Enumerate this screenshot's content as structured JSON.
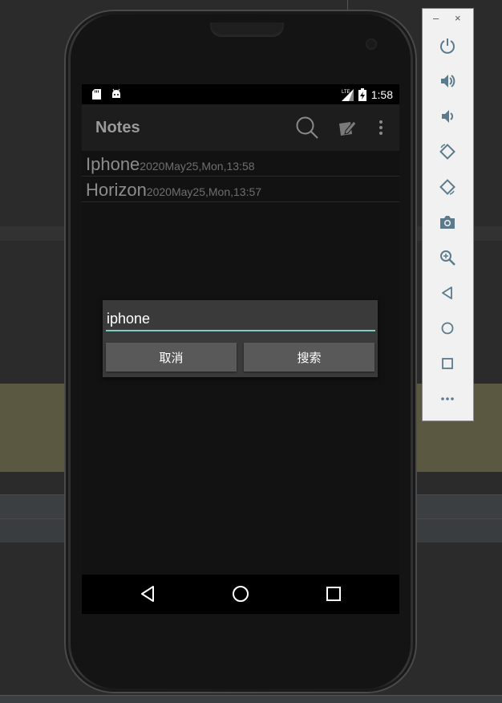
{
  "emulator": {
    "window_controls": {
      "minimize": "–",
      "close": "×"
    },
    "side_buttons": [
      "power-icon",
      "volume-up-icon",
      "volume-down-icon",
      "rotate-left-icon",
      "rotate-right-icon",
      "camera-icon",
      "zoom-in-icon",
      "back-icon",
      "home-icon",
      "overview-icon",
      "more-icon"
    ]
  },
  "statusbar": {
    "time": "1:58",
    "network": "LTE"
  },
  "actionbar": {
    "title": "Notes"
  },
  "notes": [
    {
      "title": "Iphone",
      "time": "2020May25,Mon,13:58"
    },
    {
      "title": "Horizon",
      "time": "2020May25,Mon,13:57"
    }
  ],
  "dialog": {
    "input_value": "iphone",
    "cancel_label": "取消",
    "search_label": "搜索"
  },
  "colors": {
    "accent": "#80cbc4",
    "olive_band": "#5a5840"
  }
}
